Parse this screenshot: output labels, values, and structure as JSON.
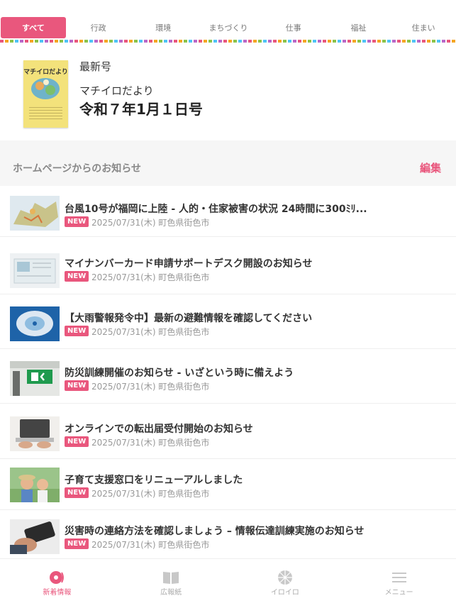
{
  "tabs": [
    {
      "label": "すべて",
      "active": true
    },
    {
      "label": "行政",
      "active": false
    },
    {
      "label": "環境",
      "active": false
    },
    {
      "label": "まちづくり",
      "active": false
    },
    {
      "label": "仕事",
      "active": false
    },
    {
      "label": "福祉",
      "active": false
    },
    {
      "label": "住まい",
      "active": false
    }
  ],
  "latest": {
    "label": "最新号",
    "name": "マチイロだより",
    "issue": "令和７年1月１日号",
    "cover_title": "マチイロだより"
  },
  "section": {
    "title": "ホームページからのお知らせ",
    "edit_label": "編集"
  },
  "news": [
    {
      "title": "台風10号が福岡に上陸 - 人的・住家被害の状況 24時間に300ﾐﾘ...",
      "badge": "NEW",
      "meta": "2025/07/31(木) 町色県街色市",
      "thumb": "map"
    },
    {
      "title": "マイナンバーカード申請サポートデスク開設のお知らせ",
      "badge": "NEW",
      "meta": "2025/07/31(木) 町色県街色市",
      "thumb": "document"
    },
    {
      "title": "【大雨警報発令中】最新の避難情報を確認してください",
      "badge": "NEW",
      "meta": "2025/07/31(木) 町色県街色市",
      "thumb": "typhoon"
    },
    {
      "title": "防災訓練開催のお知らせ - いざという時に備えよう",
      "badge": "NEW",
      "meta": "2025/07/31(木) 町色県街色市",
      "thumb": "exit-sign"
    },
    {
      "title": "オンラインでの転出届受付開始のお知らせ",
      "badge": "NEW",
      "meta": "2025/07/31(木) 町色県街色市",
      "thumb": "laptop"
    },
    {
      "title": "子育て支援窓口をリニューアルしました",
      "badge": "NEW",
      "meta": "2025/07/31(木) 町色県街色市",
      "thumb": "children"
    },
    {
      "title": "災害時の連絡方法を確認しましょう – 情報伝達訓練実施のお知らせ",
      "badge": "NEW",
      "meta": "2025/07/31(木) 町色県街色市",
      "thumb": "phone"
    }
  ],
  "nav": [
    {
      "label": "新着情報",
      "icon": "news-icon",
      "active": true
    },
    {
      "label": "広報紙",
      "icon": "book-icon",
      "active": false
    },
    {
      "label": "イロイロ",
      "icon": "globe-icon",
      "active": false
    },
    {
      "label": "メニュー",
      "icon": "menu-icon",
      "active": false
    }
  ],
  "colors": {
    "accent": "#e9577d",
    "cover": "#f3e27b"
  }
}
